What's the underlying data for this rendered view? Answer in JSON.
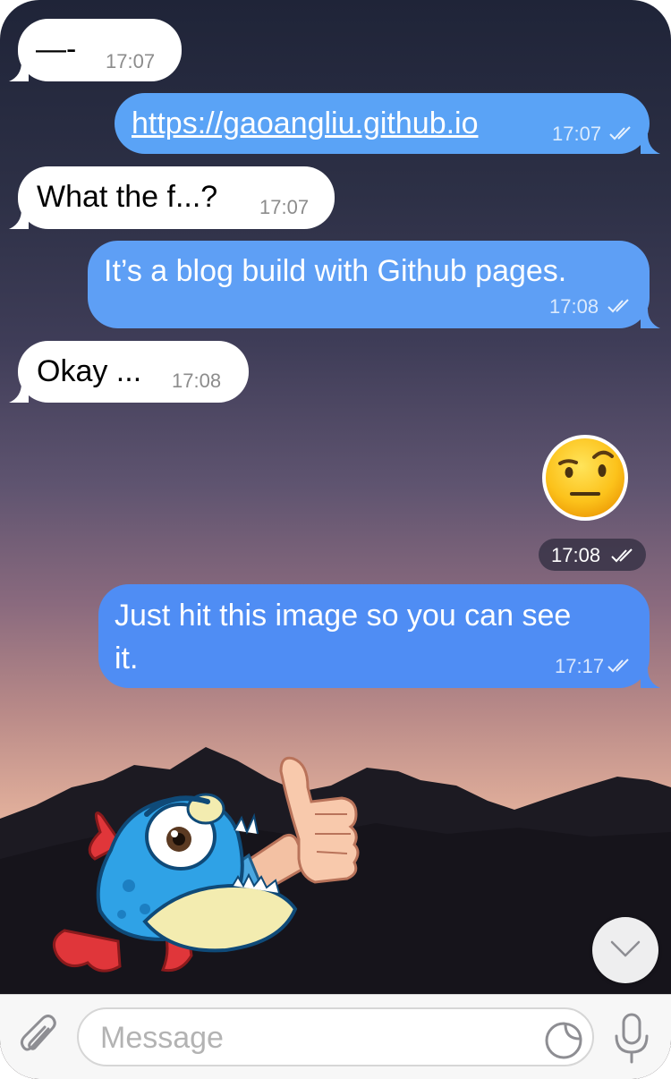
{
  "messages": [
    {
      "direction": "incoming",
      "text": "—-",
      "time": "17:07"
    },
    {
      "direction": "outgoing",
      "text": "https://gaoangliu.github.io",
      "time": "17:07",
      "is_link": true,
      "read": true
    },
    {
      "direction": "incoming",
      "text": "What the f...?",
      "time": "17:07"
    },
    {
      "direction": "outgoing",
      "text": "It’s a blog build with Github pages.",
      "time": "17:08",
      "read": true
    },
    {
      "direction": "incoming",
      "text": "Okay ...",
      "time": "17:08"
    },
    {
      "direction": "outgoing",
      "type": "sticker",
      "sticker": "raised-eyebrow-emoji",
      "time": "17:08",
      "read": true
    },
    {
      "direction": "outgoing",
      "text_line1": "Just hit this image so you can see",
      "text_line2": "it.",
      "time": "17:17",
      "read": true
    }
  ],
  "sticker_overlay": {
    "sticker": "fish-thumbs-up-sticker"
  },
  "composer": {
    "placeholder": "Message",
    "attach_icon": "paperclip-icon",
    "sticker_icon": "sticker-icon",
    "mic_icon": "microphone-icon",
    "scroll_icon": "chevron-down-icon"
  },
  "colors": {
    "outgoing_bubble": "#5a9cf5",
    "incoming_bubble": "#ffffff",
    "input_bar": "#f7f7f7"
  }
}
